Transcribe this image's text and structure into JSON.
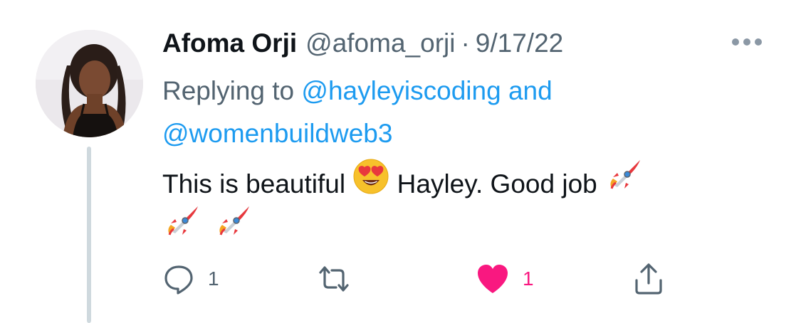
{
  "tweet": {
    "author_name": "Afoma Orji",
    "handle": "@afoma_orji",
    "separator": "·",
    "date": "9/17/22",
    "replying_prefix": "Replying to",
    "reply_to_1": "@hayleyiscoding",
    "reply_joiner": "and",
    "reply_to_2": "@womenbuildweb3",
    "text_part_1": "This is beautiful",
    "text_part_2": "Hayley. Good job",
    "emojis": [
      "heart-eyes-emoji",
      "rocket-emoji",
      "rocket-emoji",
      "rocket-emoji"
    ]
  },
  "actions": {
    "reply_count": "1",
    "retweet_count": "",
    "like_count": "1",
    "liked": true
  },
  "colors": {
    "link": "#1d9bf0",
    "secondary_text": "#536471",
    "like": "#f91880",
    "thread_line": "#cfd9de"
  },
  "icons": [
    "more-icon",
    "reply-icon",
    "retweet-icon",
    "like-icon",
    "share-icon"
  ]
}
